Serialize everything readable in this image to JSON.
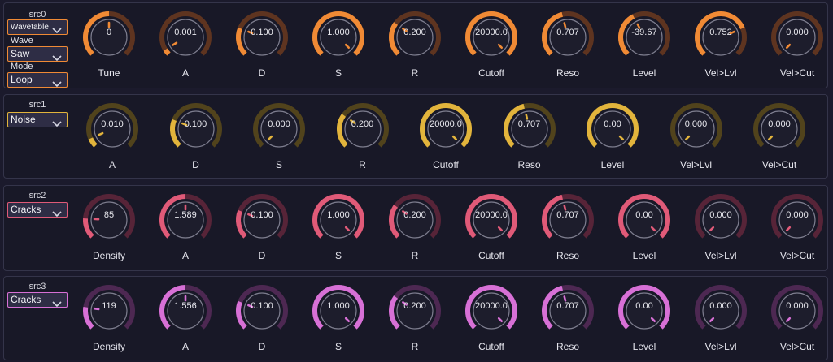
{
  "sources": [
    {
      "title": "src0",
      "accent": "#f08a35",
      "track": "#5e3420",
      "selectors": [
        {
          "label": "",
          "value": "Wavetable",
          "small": true
        },
        {
          "label": "Wave",
          "value": "Saw"
        },
        {
          "label": "Mode",
          "value": "Loop"
        }
      ],
      "knobs": [
        {
          "label": "Tune",
          "value": "0",
          "level": 0.5
        },
        {
          "label": "A",
          "value": "0.001",
          "level": 0.05
        },
        {
          "label": "D",
          "value": "0.100",
          "level": 0.25
        },
        {
          "label": "S",
          "value": "1.000",
          "level": 1.0
        },
        {
          "label": "R",
          "value": "0.200",
          "level": 0.3
        },
        {
          "label": "Cutoff",
          "value": "20000.0",
          "level": 1.0
        },
        {
          "label": "Reso",
          "value": "0.707",
          "level": 0.45
        },
        {
          "label": "Level",
          "value": "-39.67",
          "level": 0.4
        },
        {
          "label": "Vel>Lvl",
          "value": "0.752",
          "level": 0.75
        },
        {
          "label": "Vel>Cut",
          "value": "0.000",
          "level": 0.0
        }
      ]
    },
    {
      "title": "src1",
      "accent": "#e2b43c",
      "track": "#51431c",
      "selectors": [
        {
          "label": "",
          "value": "Noise"
        }
      ],
      "knobs": [
        {
          "label": "A",
          "value": "0.010",
          "level": 0.08
        },
        {
          "label": "D",
          "value": "0.100",
          "level": 0.25
        },
        {
          "label": "S",
          "value": "0.000",
          "level": 0.0
        },
        {
          "label": "R",
          "value": "0.200",
          "level": 0.3
        },
        {
          "label": "Cutoff",
          "value": "20000.0",
          "level": 1.0
        },
        {
          "label": "Reso",
          "value": "0.707",
          "level": 0.45
        },
        {
          "label": "Level",
          "value": "0.00",
          "level": 1.0
        },
        {
          "label": "Vel>Lvl",
          "value": "0.000",
          "level": 0.0
        },
        {
          "label": "Vel>Cut",
          "value": "0.000",
          "level": 0.0
        }
      ]
    },
    {
      "title": "src2",
      "accent": "#e05a78",
      "track": "#572438",
      "selectors": [
        {
          "label": "",
          "value": "Cracks"
        }
      ],
      "knobs": [
        {
          "label": "Density",
          "value": "85",
          "level": 0.18
        },
        {
          "label": "A",
          "value": "1.589",
          "level": 0.5
        },
        {
          "label": "D",
          "value": "0.100",
          "level": 0.25
        },
        {
          "label": "S",
          "value": "1.000",
          "level": 1.0
        },
        {
          "label": "R",
          "value": "0.200",
          "level": 0.3
        },
        {
          "label": "Cutoff",
          "value": "20000.0",
          "level": 1.0
        },
        {
          "label": "Reso",
          "value": "0.707",
          "level": 0.45
        },
        {
          "label": "Level",
          "value": "0.00",
          "level": 1.0
        },
        {
          "label": "Vel>Lvl",
          "value": "0.000",
          "level": 0.0
        },
        {
          "label": "Vel>Cut",
          "value": "0.000",
          "level": 0.0
        }
      ]
    },
    {
      "title": "src3",
      "accent": "#d770d6",
      "track": "#4d2852",
      "selectors": [
        {
          "label": "",
          "value": "Cracks"
        }
      ],
      "knobs": [
        {
          "label": "Density",
          "value": "119",
          "level": 0.2
        },
        {
          "label": "A",
          "value": "1.556",
          "level": 0.5
        },
        {
          "label": "D",
          "value": "0.100",
          "level": 0.25
        },
        {
          "label": "S",
          "value": "1.000",
          "level": 1.0
        },
        {
          "label": "R",
          "value": "0.200",
          "level": 0.3
        },
        {
          "label": "Cutoff",
          "value": "20000.0",
          "level": 1.0
        },
        {
          "label": "Reso",
          "value": "0.707",
          "level": 0.45
        },
        {
          "label": "Level",
          "value": "0.00",
          "level": 1.0
        },
        {
          "label": "Vel>Lvl",
          "value": "0.000",
          "level": 0.0
        },
        {
          "label": "Vel>Cut",
          "value": "0.000",
          "level": 0.0
        }
      ]
    }
  ]
}
